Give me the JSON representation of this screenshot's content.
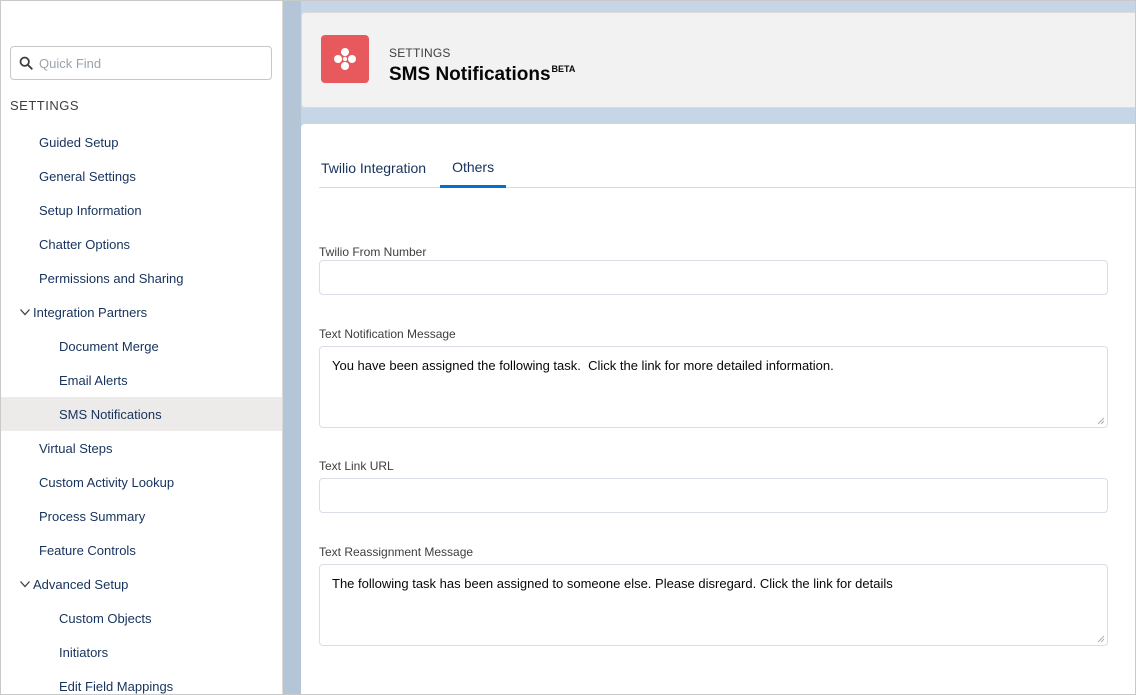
{
  "sidebar": {
    "search_placeholder": "Quick Find",
    "section_label": "SETTINGS",
    "items": [
      {
        "label": "Guided Setup",
        "level": 1
      },
      {
        "label": "General Settings",
        "level": 1
      },
      {
        "label": "Setup Information",
        "level": 1
      },
      {
        "label": "Chatter Options",
        "level": 1
      },
      {
        "label": "Permissions and Sharing",
        "level": 1
      },
      {
        "label": "Integration Partners",
        "level": 0,
        "expanded": true
      },
      {
        "label": "Document Merge",
        "level": 2
      },
      {
        "label": "Email Alerts",
        "level": 2
      },
      {
        "label": "SMS Notifications",
        "level": 2,
        "active": true
      },
      {
        "label": "Virtual Steps",
        "level": 1
      },
      {
        "label": "Custom Activity Lookup",
        "level": 1
      },
      {
        "label": "Process Summary",
        "level": 1
      },
      {
        "label": "Feature Controls",
        "level": 1
      },
      {
        "label": "Advanced Setup",
        "level": 0,
        "expanded": true
      },
      {
        "label": "Custom Objects",
        "level": 2
      },
      {
        "label": "Initiators",
        "level": 2
      },
      {
        "label": "Edit Field Mappings",
        "level": 2
      }
    ]
  },
  "header": {
    "eyebrow": "SETTINGS",
    "title": "SMS Notifications",
    "badge": "BETA",
    "icon": "sms-app-icon",
    "icon_color": "#e8595d"
  },
  "tabs": [
    {
      "label": "Twilio Integration",
      "active": false
    },
    {
      "label": "Others",
      "active": true
    }
  ],
  "form": {
    "from_number": {
      "label": "Twilio From Number",
      "value": ""
    },
    "notification_message": {
      "label": "Text Notification Message",
      "value": "You have been assigned the following task.  Click the link for more detailed information."
    },
    "link_url": {
      "label": "Text Link URL",
      "value": ""
    },
    "reassignment_message": {
      "label": "Text Reassignment Message",
      "value": "The following task has been assigned to someone else. Please disregard. Click the link for details"
    }
  },
  "colors": {
    "accent": "#0070d2",
    "active_row": "#ecebea",
    "background_blue": "#c7d6e7"
  }
}
